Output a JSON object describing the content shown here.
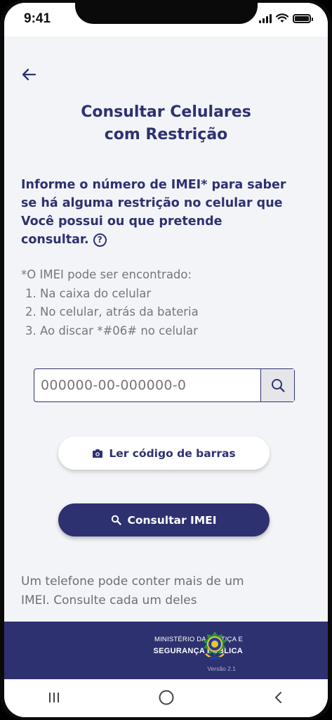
{
  "status": {
    "time": "9:41"
  },
  "header": {
    "title_line1": "Consultar Celulares",
    "title_line2": "com Restrição"
  },
  "info": {
    "line1": "Informe o número de IMEI* para saber",
    "line2": "se há alguma restrição no celular que",
    "line3": "Você possui ou que pretende",
    "line4": "consultar."
  },
  "note": {
    "heading": "*O IMEI pode ser encontrado:",
    "items": [
      "1. Na caixa do celular",
      "2. No celular, atrás da bateria",
      "3. Ao discar *#06# no celular"
    ]
  },
  "imei_input": {
    "placeholder": "000000-00-000000-0"
  },
  "buttons": {
    "barcode_label": "Ler código de barras",
    "consult_label": "Consultar IMEI"
  },
  "footnote": {
    "line1": "Um telefone pode conter mais de um",
    "line2": "IMEI. Consulte cada um deles"
  },
  "footer": {
    "ministry_line1": "MINISTÉRIO DA JUSTIÇA E",
    "ministry_line2": "SEGURANÇA PÚBLICA",
    "version": "Versão 2.1"
  },
  "icons": [
    "signal-icon",
    "wifi-icon",
    "battery-icon",
    "back-arrow-icon",
    "help-icon",
    "search-icon",
    "camera-icon",
    "coat-of-arms-icon",
    "nav-recents-icon",
    "nav-home-icon",
    "nav-back-icon"
  ],
  "colors": {
    "primary": "#2e3170",
    "background": "#f3f4f8",
    "muted_text": "#76767a"
  }
}
